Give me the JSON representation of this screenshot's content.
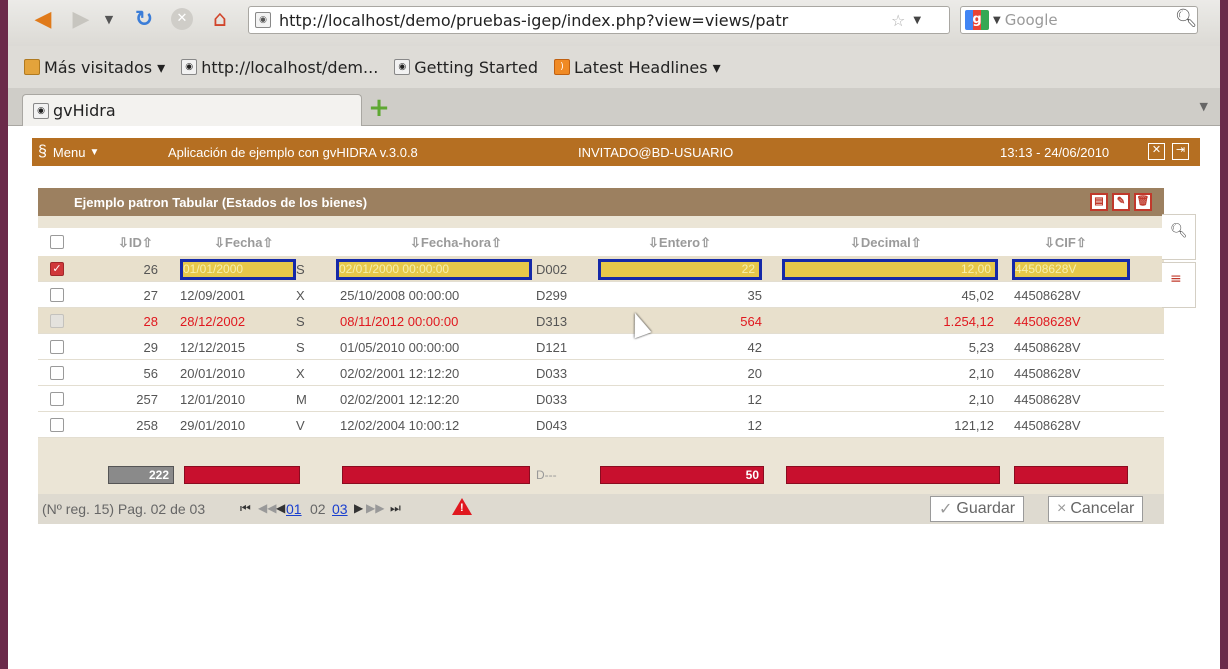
{
  "browser": {
    "url": "http://localhost/demo/pruebas-igep/index.php?view=views/patr",
    "search_placeholder": "Google",
    "bookmarks": [
      {
        "label": "Más visitados ▾",
        "icon": "folder-icon"
      },
      {
        "label": "http://localhost/dem...",
        "icon": "page-icon"
      },
      {
        "label": "Getting Started",
        "icon": "page-icon"
      },
      {
        "label": "Latest Headlines ▾",
        "icon": "rss-icon"
      }
    ],
    "tab_label": "gvHidra"
  },
  "app": {
    "menu_label": "Menu",
    "title": "Aplicación de ejemplo con gvHIDRA  v.3.0.8",
    "user": "INVITADO@BD-USUARIO",
    "time": "13:13 - 24/06/2010"
  },
  "panel": {
    "title": "Ejemplo patron Tabular (Estados de los bienes)",
    "columns": [
      "ID",
      "Fecha",
      "Fecha-hora",
      "Entero",
      "Decimal",
      "CIF"
    ],
    "rows": [
      {
        "id": "26",
        "fecha": "01/01/2000",
        "s": "S",
        "fh": "02/01/2000 00:00:00",
        "d": "D002",
        "entero": "22",
        "decimal": "12,00",
        "cif": "44508628V",
        "state": "selected"
      },
      {
        "id": "27",
        "fecha": "12/09/2001",
        "s": "X",
        "fh": "25/10/2008 00:00:00",
        "d": "D299",
        "entero": "35",
        "decimal": "45,02",
        "cif": "44508628V",
        "state": "normal"
      },
      {
        "id": "28",
        "fecha": "28/12/2002",
        "s": "S",
        "fh": "08/11/2012 00:00:00",
        "d": "D313",
        "entero": "564",
        "decimal": "1.254,12",
        "cif": "44508628V",
        "state": "red"
      },
      {
        "id": "29",
        "fecha": "12/12/2015",
        "s": "S",
        "fh": "01/05/2010 00:00:00",
        "d": "D121",
        "entero": "42",
        "decimal": "5,23",
        "cif": "44508628V",
        "state": "normal"
      },
      {
        "id": "56",
        "fecha": "20/01/2010",
        "s": "X",
        "fh": "02/02/2001 12:12:20",
        "d": "D033",
        "entero": "20",
        "decimal": "2,10",
        "cif": "44508628V",
        "state": "normal"
      },
      {
        "id": "257",
        "fecha": "12/01/2010",
        "s": "M",
        "fh": "02/02/2001 12:12:20",
        "d": "D033",
        "entero": "12",
        "decimal": "2,10",
        "cif": "44508628V",
        "state": "normal"
      },
      {
        "id": "258",
        "fecha": "29/01/2010",
        "s": "V",
        "fh": "12/02/2004 10:00:12",
        "d": "D043",
        "entero": "12",
        "decimal": "121,12",
        "cif": "44508628V",
        "state": "normal"
      }
    ],
    "new_row": {
      "id": "222",
      "d": "D---",
      "entero": "50"
    },
    "pager": {
      "info": "(Nº reg. 15) Pag. 02 de 03",
      "page1": "01",
      "page_current": "02",
      "page3": "03"
    },
    "save_label": "Guardar",
    "cancel_label": "Cancelar"
  },
  "colors": {
    "header": "#b56f22",
    "panel_head": "#9c8060",
    "error_red": "#e0181f",
    "edit_border": "#1529a8"
  }
}
